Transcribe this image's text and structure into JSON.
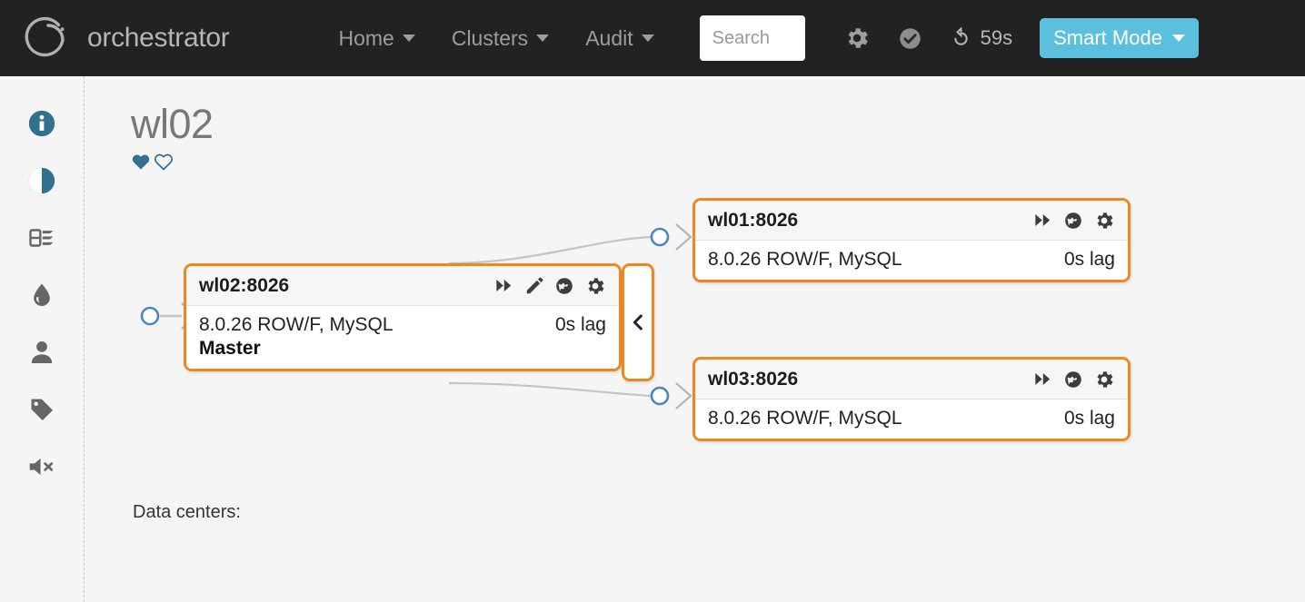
{
  "header": {
    "brand": "orchestrator",
    "logo_icon": "orchestrator-ring-logo",
    "nav": [
      {
        "label": "Home",
        "icon": "chevron-down-icon"
      },
      {
        "label": "Clusters",
        "icon": "chevron-down-icon"
      },
      {
        "label": "Audit",
        "icon": "chevron-down-icon"
      }
    ],
    "search": {
      "value": "",
      "placeholder": "Search"
    },
    "icons": [
      {
        "name": "gear-icon"
      },
      {
        "name": "check-circle-icon"
      }
    ],
    "refresh": {
      "icon": "refresh-icon",
      "label": "59s"
    },
    "smart_mode": {
      "label": "Smart Mode",
      "icon": "caret-down-icon",
      "color": "#5bc0de"
    }
  },
  "sidebar": {
    "items": [
      {
        "name": "info-icon",
        "label": "Info",
        "color": "#31708f"
      },
      {
        "name": "contrast-icon",
        "label": "Compare",
        "color": "#31708f"
      },
      {
        "name": "server-icon",
        "label": "Pools",
        "color": "#666666"
      },
      {
        "name": "droplet-icon",
        "label": "Blood",
        "color": "#666666"
      },
      {
        "name": "user-icon",
        "label": "User",
        "color": "#666666"
      },
      {
        "name": "tag-icon",
        "label": "Tags",
        "color": "#666666"
      },
      {
        "name": "mute-icon",
        "label": "Mute alerts",
        "color": "#666666"
      }
    ]
  },
  "main": {
    "title": "wl02",
    "hearts": [
      {
        "name": "heart-filled-icon",
        "state": "filled",
        "color": "#31708f"
      },
      {
        "name": "heart-outline-icon",
        "state": "outline",
        "color": "#31708f"
      }
    ],
    "data_centers_label": "Data centers:",
    "data_centers": []
  },
  "topology": {
    "accent_border": "#f0871e",
    "link_color": "#c4c4c4",
    "anchor_color": "#4a86c5",
    "collapse_tab": {
      "icon": "chevron-left-icon",
      "name": "collapse-downstream-tab"
    },
    "nodes": [
      {
        "id": "master",
        "title": "wl02:8026",
        "version": "8.0.26 ROW/F, MySQL",
        "lag": "0s lag",
        "role": "Master",
        "actions": [
          {
            "name": "fast-forward-icon"
          },
          {
            "name": "pencil-icon"
          },
          {
            "name": "globe-icon"
          },
          {
            "name": "gear-icon"
          }
        ]
      },
      {
        "id": "wl01",
        "title": "wl01:8026",
        "version": "8.0.26 ROW/F, MySQL",
        "lag": "0s lag",
        "role": "",
        "actions": [
          {
            "name": "fast-forward-icon"
          },
          {
            "name": "globe-icon"
          },
          {
            "name": "gear-icon"
          }
        ]
      },
      {
        "id": "wl03",
        "title": "wl03:8026",
        "version": "8.0.26 ROW/F, MySQL",
        "lag": "0s lag",
        "role": "",
        "actions": [
          {
            "name": "fast-forward-icon"
          },
          {
            "name": "globe-icon"
          },
          {
            "name": "gear-icon"
          }
        ]
      }
    ]
  }
}
